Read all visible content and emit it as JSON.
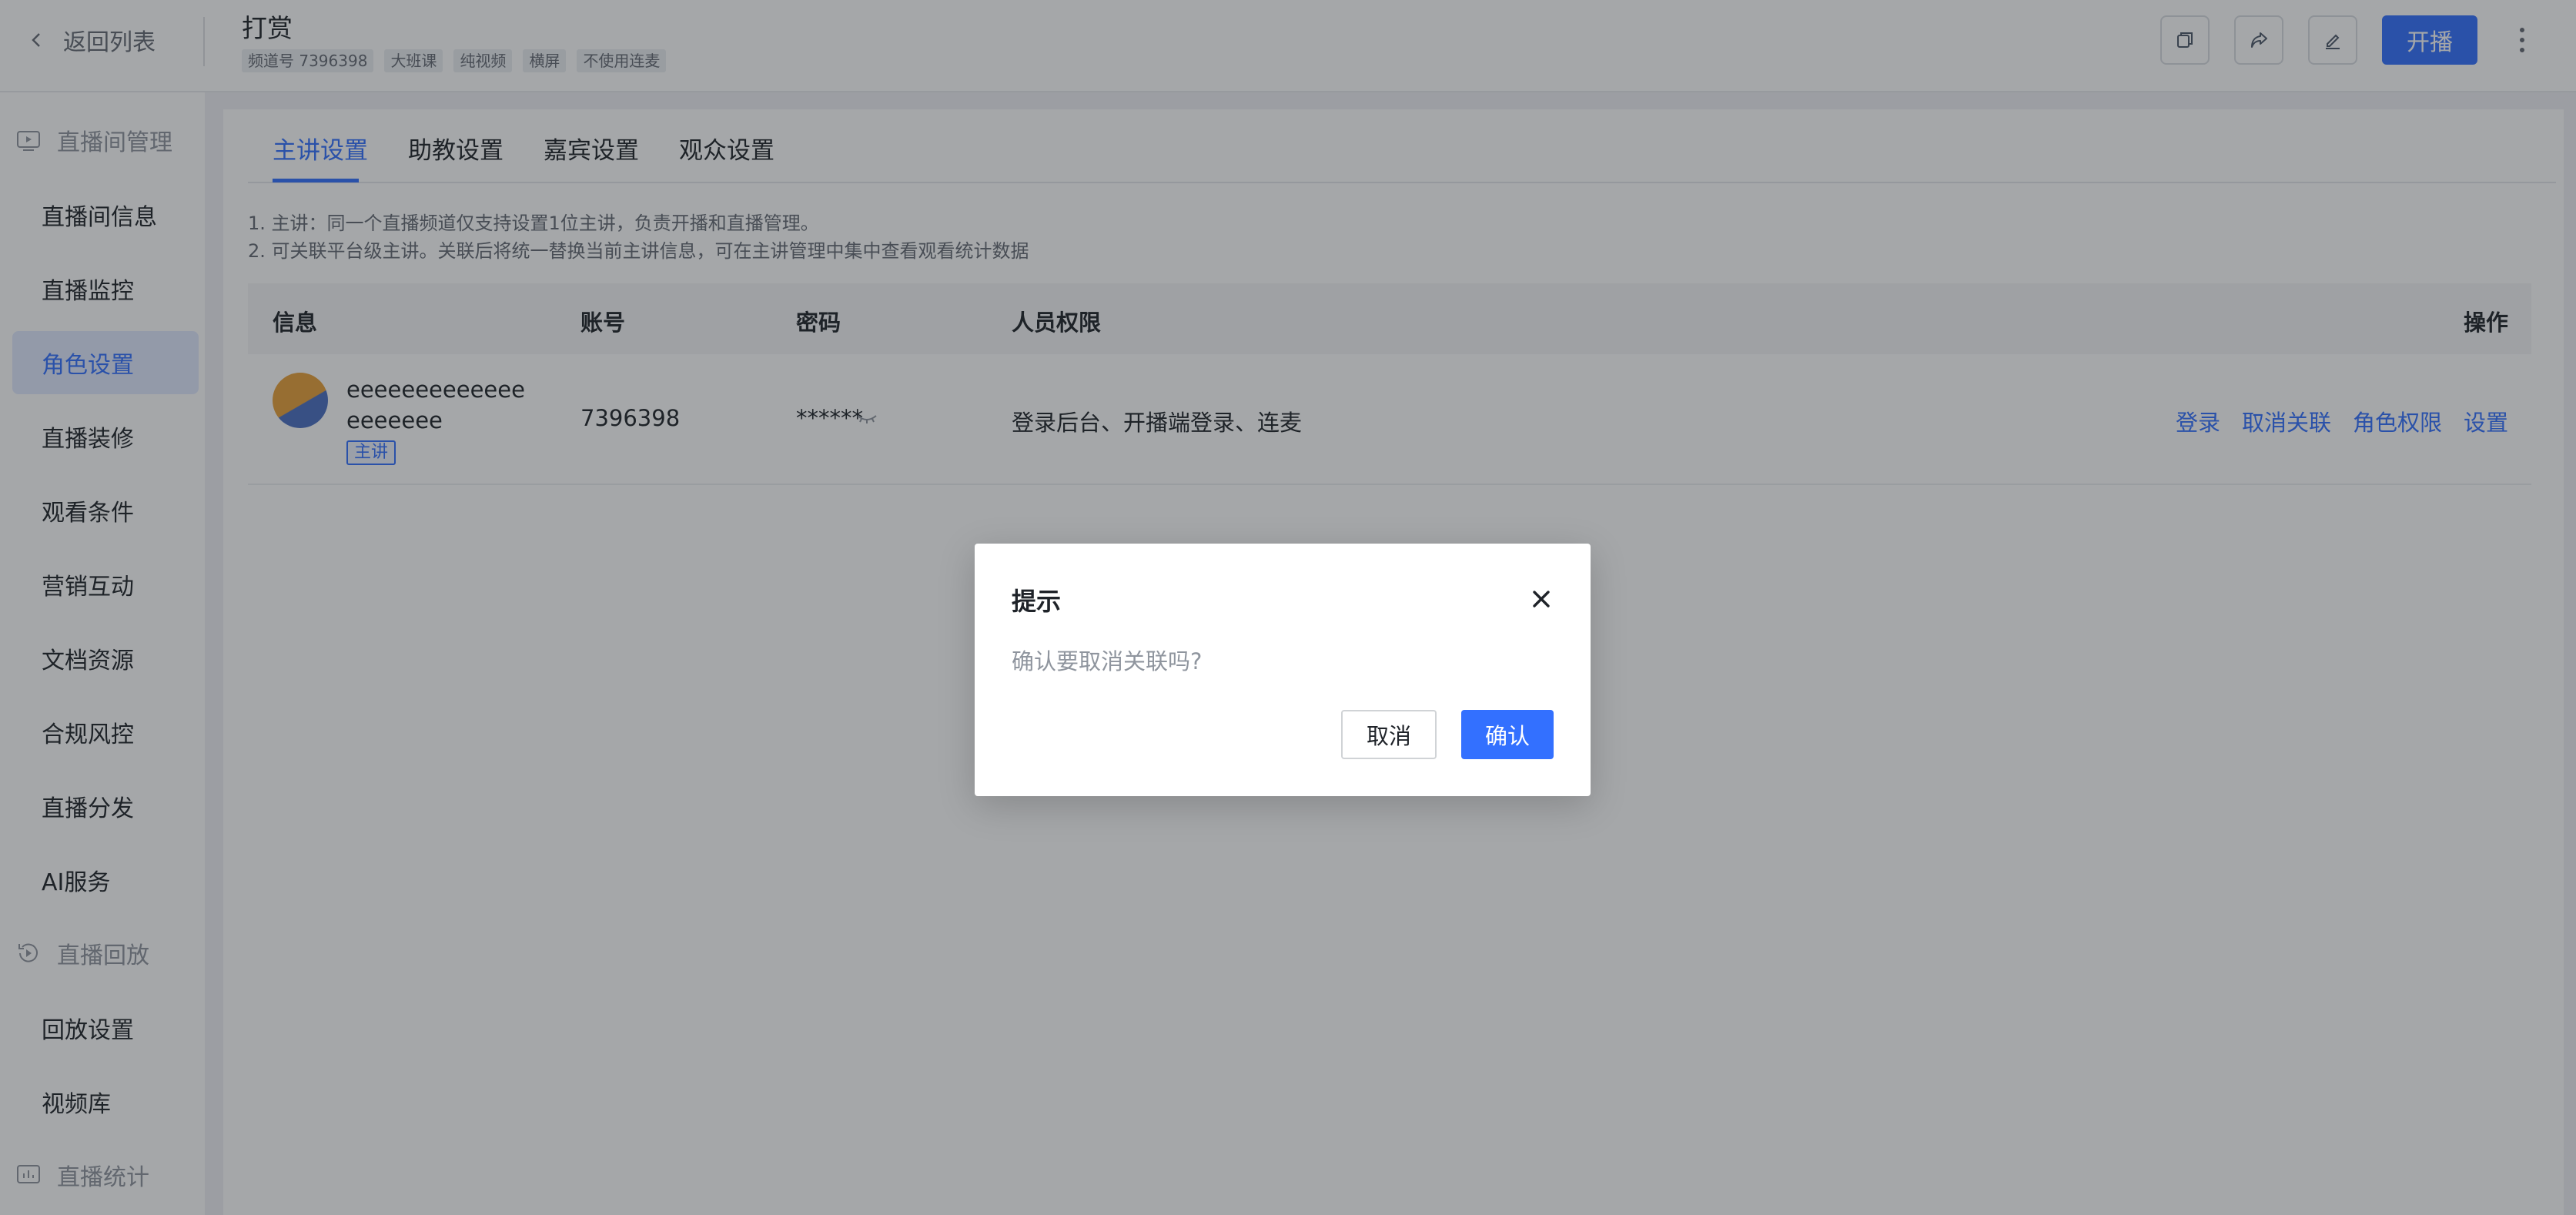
{
  "header": {
    "back_label": "返回列表",
    "title": "打赏",
    "tags": [
      "频道号 7396398",
      "大班课",
      "纯视频",
      "横屏",
      "不使用连麦"
    ],
    "start_label": "开播",
    "icons": [
      "copy-icon",
      "share-icon",
      "edit-icon",
      "more-icon"
    ]
  },
  "sidebar": {
    "groups": [
      {
        "label": "直播间管理",
        "icon": "live-room-icon"
      },
      {
        "label": "直播回放",
        "icon": "replay-icon"
      },
      {
        "label": "直播统计",
        "icon": "stats-icon"
      }
    ],
    "items": [
      {
        "label": "直播间信息"
      },
      {
        "label": "直播监控"
      },
      {
        "label": "角色设置",
        "active": true
      },
      {
        "label": "直播装修"
      },
      {
        "label": "观看条件"
      },
      {
        "label": "营销互动"
      },
      {
        "label": "文档资源"
      },
      {
        "label": "合规风控"
      },
      {
        "label": "直播分发"
      },
      {
        "label": "AI服务"
      },
      {
        "label": "回放设置"
      },
      {
        "label": "视频库"
      }
    ]
  },
  "main": {
    "tabs": [
      {
        "label": "主讲设置",
        "active": true
      },
      {
        "label": "助教设置"
      },
      {
        "label": "嘉宾设置"
      },
      {
        "label": "观众设置"
      }
    ],
    "tips": [
      "1. 主讲：同一个直播频道仅支持设置1位主讲，负责开播和直播管理。",
      "2. 可关联平台级主讲。关联后将统一替换当前主讲信息，可在主讲管理中集中查看观看统计数据"
    ],
    "table": {
      "columns": [
        "信息",
        "账号",
        "密码",
        "人员权限",
        "操作"
      ],
      "rows": [
        {
          "name": "eeeeeeeeeeeeeeeeeeee",
          "role": "主讲",
          "account": "7396398",
          "password": "******",
          "permissions": "登录后台、开播端登录、连麦",
          "actions": [
            "登录",
            "取消关联",
            "角色权限",
            "设置"
          ]
        }
      ]
    }
  },
  "dialog": {
    "title": "提示",
    "message": "确认要取消关联吗?",
    "cancel_label": "取消",
    "confirm_label": "确认"
  },
  "colors": {
    "accent": "#3370ff",
    "overlay": "rgba(31,35,41,0.40)"
  }
}
